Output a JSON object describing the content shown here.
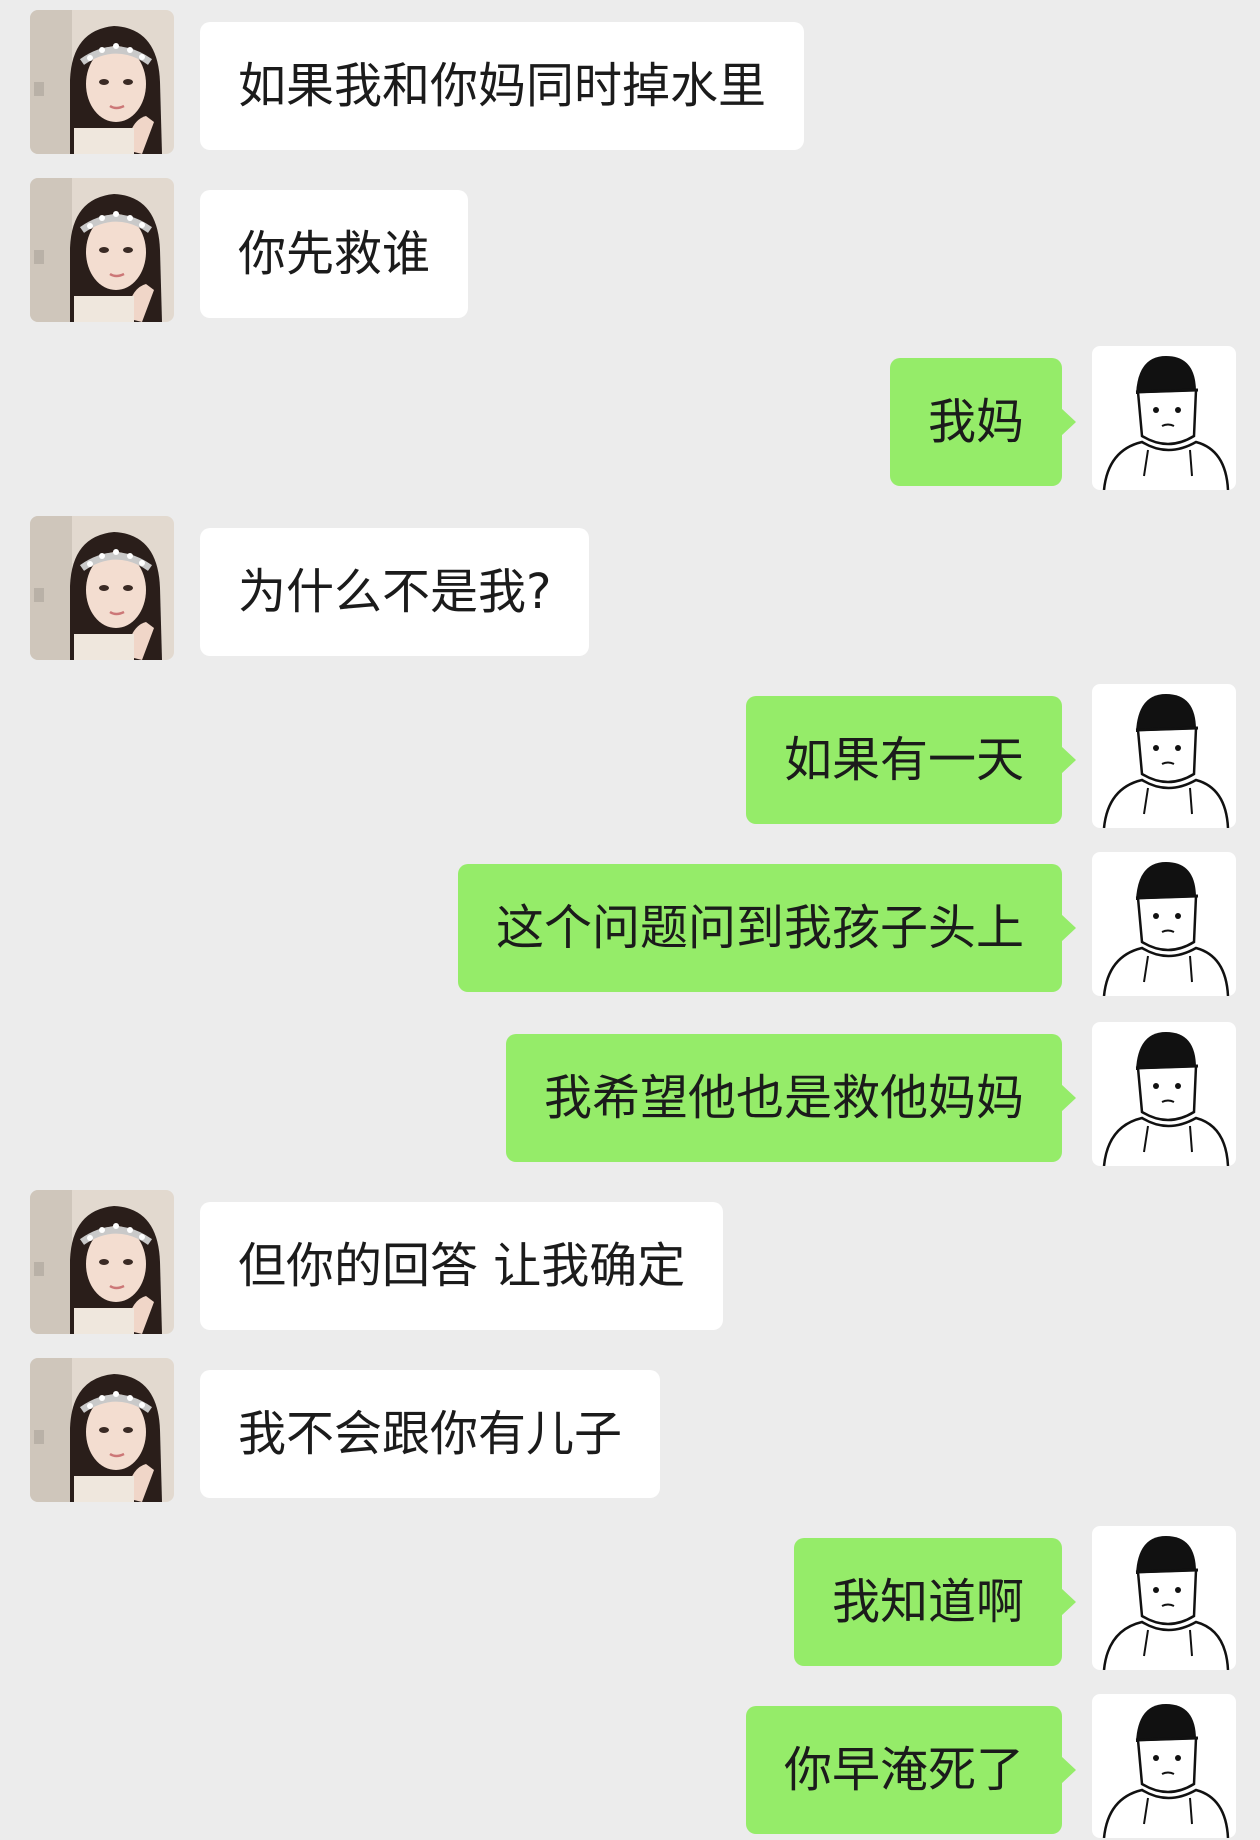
{
  "chat": {
    "messages": [
      {
        "side": "left",
        "sender": "girl",
        "text": "如果我和你妈同时掉水里"
      },
      {
        "side": "left",
        "sender": "girl",
        "text": "你先救谁"
      },
      {
        "side": "right",
        "sender": "boy",
        "text": "我妈"
      },
      {
        "side": "left",
        "sender": "girl",
        "text": "为什么不是我?"
      },
      {
        "side": "right",
        "sender": "boy",
        "text": "如果有一天"
      },
      {
        "side": "right",
        "sender": "boy",
        "text": "这个问题问到我孩子头上"
      },
      {
        "side": "right",
        "sender": "boy",
        "text": "我希望他也是救他妈妈"
      },
      {
        "side": "left",
        "sender": "girl",
        "text": "但你的回答 让我确定"
      },
      {
        "side": "left",
        "sender": "girl",
        "text": "我不会跟你有儿子"
      },
      {
        "side": "right",
        "sender": "boy",
        "text": "我知道啊"
      },
      {
        "side": "right",
        "sender": "boy",
        "text": "你早淹死了"
      }
    ]
  },
  "colors": {
    "background": "#ececec",
    "incoming_bubble": "#ffffff",
    "outgoing_bubble": "#95ec69"
  },
  "icons": {
    "girl_avatar": "girl-photo-avatar-icon",
    "boy_avatar": "cartoon-boy-beanie-avatar-icon"
  }
}
